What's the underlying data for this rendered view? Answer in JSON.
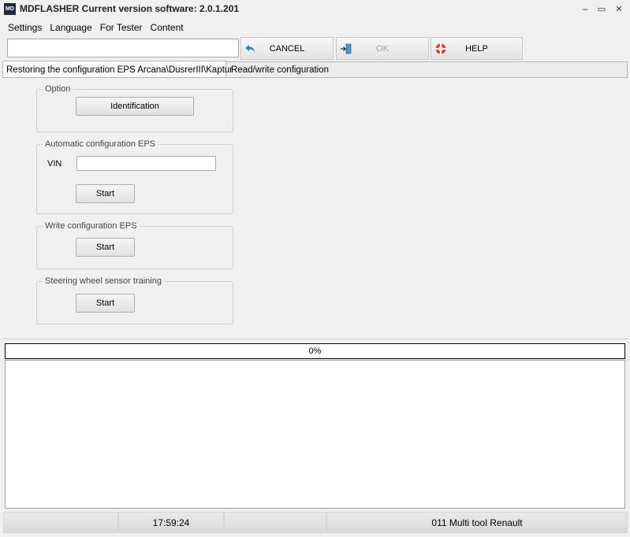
{
  "window": {
    "icon_text": "MD",
    "title": "MDFLASHER  Current version software: 2.0.1.201",
    "minimize_glyph": "–",
    "maximize_glyph": "▭",
    "close_glyph": "✕"
  },
  "menu": [
    "Settings",
    "Language",
    "For Tester",
    "Content"
  ],
  "toolbar": {
    "input_value": "",
    "cancel_label": "CANCEL",
    "ok_label": "OK",
    "help_label": "HELP",
    "ok_enabled": false
  },
  "tabs": [
    {
      "label": "Restoring the configuration EPS Arcana\\DusrerIII\\Kaptur",
      "active": true
    },
    {
      "label": "Read/write configuration",
      "active": false
    }
  ],
  "groups": {
    "option": {
      "title": "Option",
      "button": "Identification"
    },
    "auto_config": {
      "title": "Automatic configuration EPS",
      "vin_label": "VIN",
      "vin_value": "",
      "button": "Start"
    },
    "write_config": {
      "title": "Write configuration EPS",
      "button": "Start"
    },
    "sensor_training": {
      "title": "Steering wheel sensor training",
      "button": "Start"
    }
  },
  "progress": {
    "value": 0,
    "label": "0%"
  },
  "status": {
    "cell1": "",
    "time": "17:59:24",
    "cell3": "",
    "device": "011 Multi tool Renault"
  }
}
